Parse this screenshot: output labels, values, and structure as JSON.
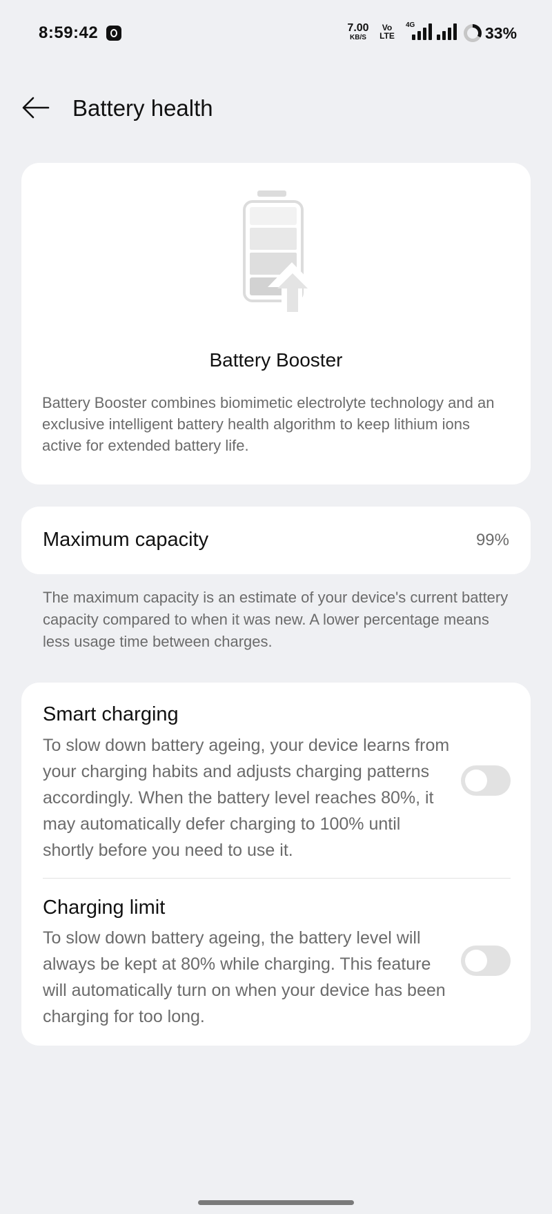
{
  "status_bar": {
    "time": "8:59:42",
    "net_speed_value": "7.00",
    "net_speed_unit": "KB/S",
    "volte_top": "Vo",
    "volte_bottom": "LTE",
    "network_label": "4G",
    "battery_percent": "33%",
    "battery_level": 0.33
  },
  "header": {
    "back_icon": "arrow-left-icon",
    "title": "Battery health"
  },
  "booster_card": {
    "icon": "battery-boost-icon",
    "title": "Battery Booster",
    "description": "Battery Booster combines biomimetic electrolyte technology and an exclusive intelligent battery health algorithm to keep lithium ions active for extended battery life."
  },
  "capacity": {
    "label": "Maximum capacity",
    "value": "99%",
    "description": "The maximum capacity is an estimate of your device's current battery capacity compared to when it was new. A lower percentage means less usage time between charges."
  },
  "settings": [
    {
      "title": "Smart charging",
      "description": "To slow down battery ageing, your device learns from your charging habits and adjusts charging patterns accordingly. When the battery level reaches 80%, it may automatically defer charging to 100% until shortly before you need to use it.",
      "enabled": false
    },
    {
      "title": "Charging limit",
      "description": "To slow down battery ageing, the battery level will always be kept at 80% while charging. This feature will automatically turn on when your device has been charging for too long.",
      "enabled": false
    }
  ],
  "colors": {
    "background": "#eff0f3",
    "card": "#ffffff",
    "secondary_text": "#6b6b6b",
    "toggle_off": "#e2e2e2"
  }
}
